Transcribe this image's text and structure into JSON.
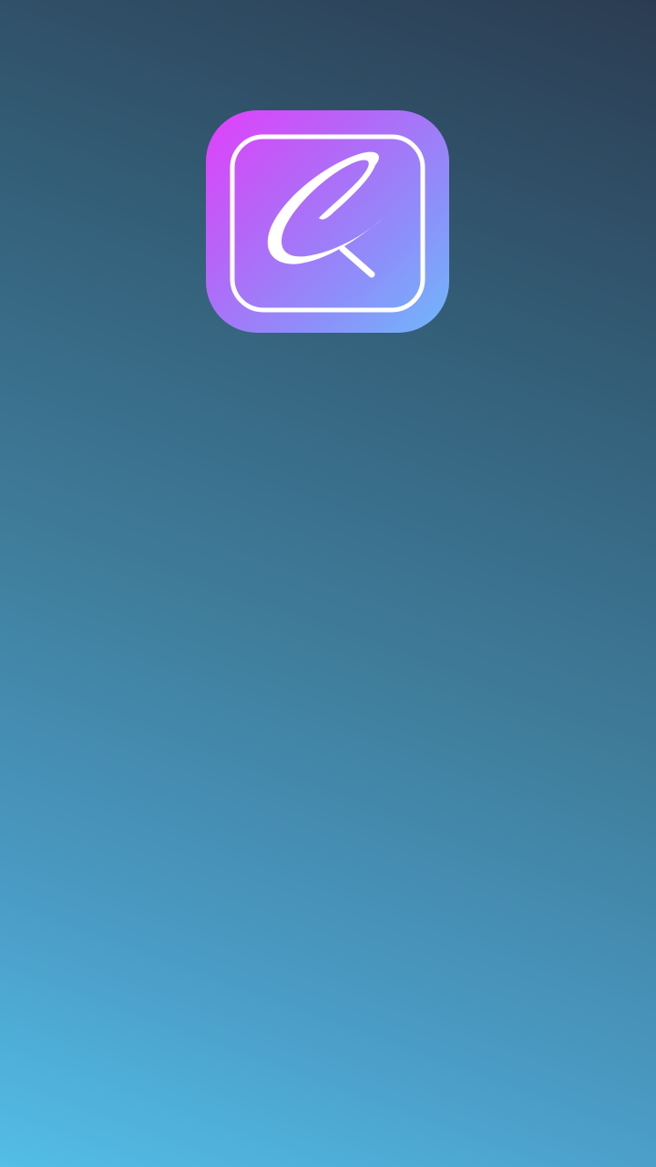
{
  "splash": {
    "logo_icon": "calligraphic-c-magnifier-icon",
    "logo_gradient": [
      "#e23ffb",
      "#8c90fa",
      "#70b8fb"
    ],
    "background_gradient": [
      "#2b3c51",
      "#3f7d9b",
      "#53bee6"
    ]
  }
}
